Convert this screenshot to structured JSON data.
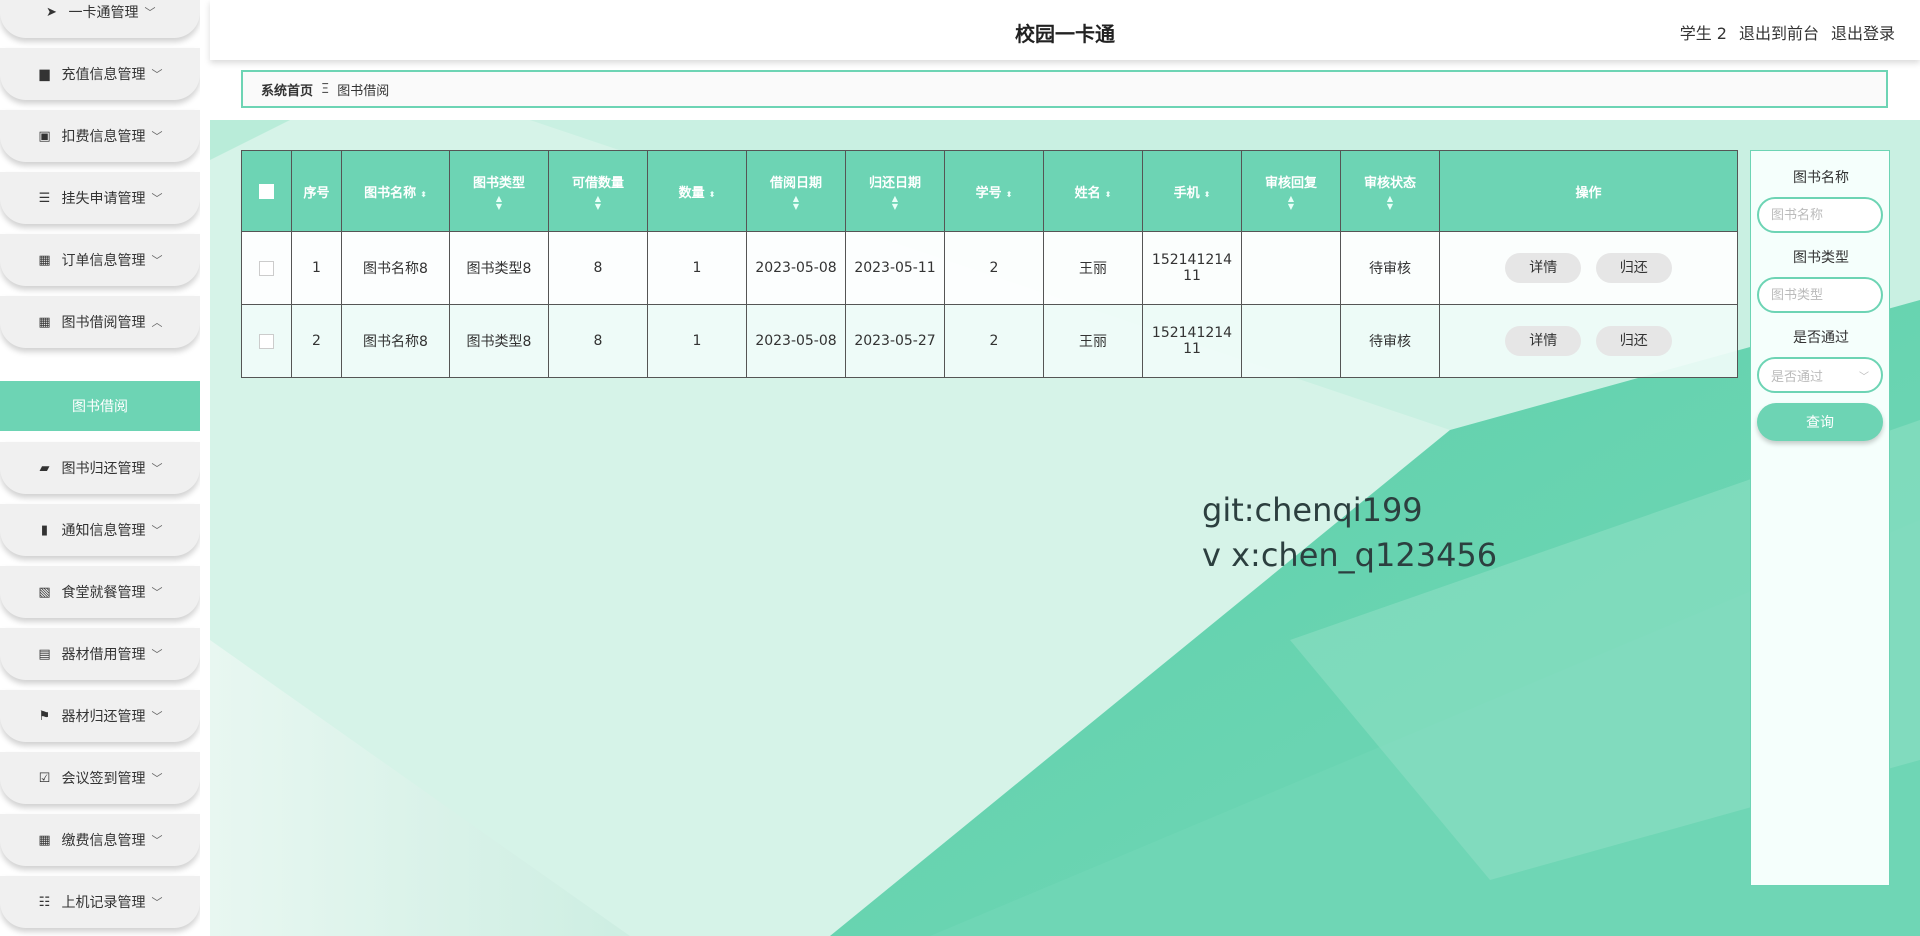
{
  "header": {
    "title": "校园一卡通",
    "user": "学生 2",
    "to_front": "退出到前台",
    "logout": "退出登录"
  },
  "sidebar": {
    "items": [
      {
        "label": "一卡通管理",
        "icon": "paper-plane-icon",
        "expanded": false
      },
      {
        "label": "充值信息管理",
        "icon": "archive-icon",
        "expanded": false
      },
      {
        "label": "扣费信息管理",
        "icon": "briefcase-icon",
        "expanded": false
      },
      {
        "label": "挂失申请管理",
        "icon": "list-icon",
        "expanded": false
      },
      {
        "label": "订单信息管理",
        "icon": "grid-icon",
        "expanded": false
      },
      {
        "label": "图书借阅管理",
        "icon": "grid-icon",
        "expanded": true
      },
      {
        "label": "图书归还管理",
        "icon": "ticket-icon",
        "expanded": false
      },
      {
        "label": "通知信息管理",
        "icon": "bar-chart-icon",
        "expanded": false
      },
      {
        "label": "食堂就餐管理",
        "icon": "clipboard-x-icon",
        "expanded": false
      },
      {
        "label": "器材借用管理",
        "icon": "clipboard-icon",
        "expanded": false
      },
      {
        "label": "器材归还管理",
        "icon": "flag-icon",
        "expanded": false
      },
      {
        "label": "会议签到管理",
        "icon": "clipboard-check-icon",
        "expanded": false
      },
      {
        "label": "缴费信息管理",
        "icon": "grid-icon",
        "expanded": false
      },
      {
        "label": "上机记录管理",
        "icon": "sliders-icon",
        "expanded": false
      }
    ],
    "active_sub": "图书借阅"
  },
  "breadcrumb": {
    "home": "系统首页",
    "separator": "Ξ",
    "current": "图书借阅"
  },
  "table": {
    "columns": [
      "序号",
      "图书名称",
      "图书类型",
      "可借数量",
      "数量",
      "借阅日期",
      "归还日期",
      "学号",
      "姓名",
      "手机",
      "审核回复",
      "审核状态",
      "操作"
    ],
    "rows": [
      {
        "index": "1",
        "book_name": "图书名称8",
        "book_type": "图书类型8",
        "available": "8",
        "qty": "1",
        "borrow_date": "2023-05-08",
        "return_date": "2023-05-11",
        "student_id": "2",
        "name": "王丽",
        "phone_a": "152141214",
        "phone_b": "11",
        "reply": "",
        "status": "待审核"
      },
      {
        "index": "2",
        "book_name": "图书名称8",
        "book_type": "图书类型8",
        "available": "8",
        "qty": "1",
        "borrow_date": "2023-05-08",
        "return_date": "2023-05-27",
        "student_id": "2",
        "name": "王丽",
        "phone_a": "152141214",
        "phone_b": "11",
        "reply": "",
        "status": "待审核"
      }
    ],
    "actions": {
      "detail": "详情",
      "return": "归还"
    }
  },
  "search": {
    "book_name_label": "图书名称",
    "book_name_placeholder": "图书名称",
    "book_type_label": "图书类型",
    "book_type_placeholder": "图书类型",
    "approved_label": "是否通过",
    "approved_placeholder": "是否通过",
    "query_label": "查询"
  },
  "watermark": {
    "line1": "git:chenqi199",
    "line2": "v x:chen_q123456"
  },
  "colors": {
    "accent": "#6dd4b4",
    "background_light": "#d9f5ec"
  }
}
